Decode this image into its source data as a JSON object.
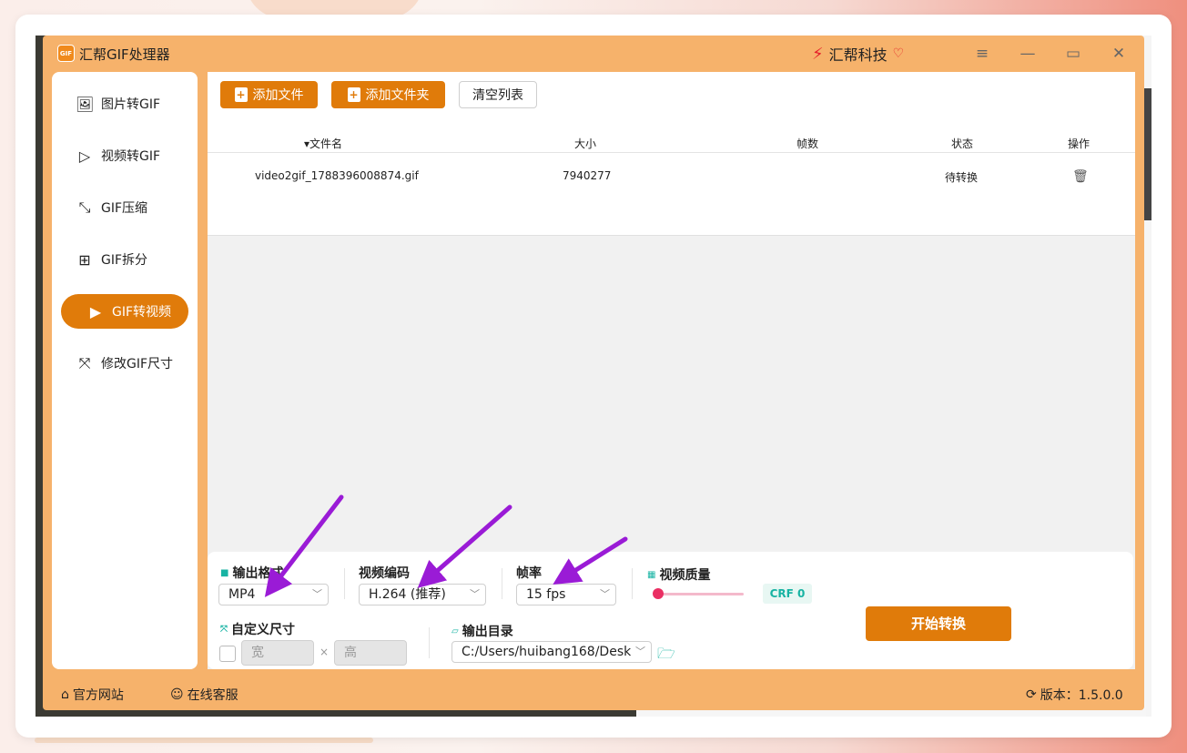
{
  "app": {
    "title": "汇帮GIF处理器",
    "logo_text": "GIF",
    "brand": "汇帮科技"
  },
  "window_controls": [
    "menu-icon",
    "minimize-icon",
    "maximize-icon",
    "close-icon"
  ],
  "sidebar": {
    "items": [
      {
        "label": "图片转GIF",
        "icon": "image-icon",
        "active": false
      },
      {
        "label": "视频转GIF",
        "icon": "play-icon",
        "active": false
      },
      {
        "label": "GIF压缩",
        "icon": "compress-icon",
        "active": false
      },
      {
        "label": "GIF拆分",
        "icon": "split-icon",
        "active": false
      },
      {
        "label": "GIF转视频",
        "icon": "video-icon",
        "active": true
      },
      {
        "label": "修改GIF尺寸",
        "icon": "resize-icon",
        "active": false
      }
    ]
  },
  "toolbar": {
    "add_file": "添加文件",
    "add_folder": "添加文件夹",
    "clear": "清空列表"
  },
  "table": {
    "columns": [
      "文件名",
      "大小",
      "帧数",
      "状态",
      "操作"
    ],
    "rows": [
      {
        "filename": "video2gif_1788396008874.gif",
        "size": "7940277",
        "frames": "",
        "status": "待转换",
        "action": "trash-icon"
      }
    ]
  },
  "settings": {
    "output_format": {
      "label": "输出格式",
      "value": "MP4"
    },
    "video_codec": {
      "label": "视频编码",
      "value": "H.264 (推荐)"
    },
    "frame_rate": {
      "label": "帧率",
      "value": "15 fps"
    },
    "video_quality": {
      "label": "视频质量",
      "crf": "CRF 0",
      "slider_fraction": 0.0
    },
    "custom_size": {
      "label": "自定义尺寸",
      "width_placeholder": "宽",
      "height_placeholder": "高",
      "times": "×"
    },
    "output_dir": {
      "label": "输出目录",
      "value": "C:/Users/huibang168/Desk"
    },
    "start_button": "开始转换"
  },
  "footer": {
    "website": "官方网站",
    "support": "在线客服",
    "version": "版本：1.5.0.0"
  },
  "colors": {
    "accent": "#e07b0a",
    "app_bg": "#f6b26b",
    "teal": "#17b3a3",
    "annotation_arrow": "#9a1bd6"
  }
}
